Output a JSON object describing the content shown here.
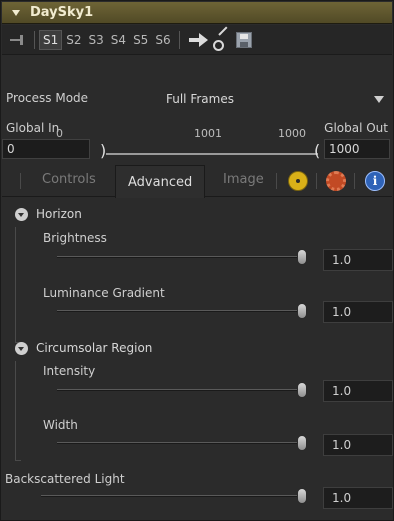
{
  "title": "DaySky1",
  "toolbar": {
    "slots": [
      "S1",
      "S2",
      "S3",
      "S4",
      "S5",
      "S6"
    ],
    "active_slot": "S1"
  },
  "process_mode": {
    "label": "Process Mode",
    "value": "Full Frames"
  },
  "range": {
    "global_in_label": "Global In",
    "global_out_label": "Global Out",
    "global_in_value": "0",
    "global_out_value": "1000",
    "tick_start": "0",
    "tick_mid": "1001",
    "tick_end": "1000"
  },
  "tabs": [
    "Controls",
    "Advanced",
    "Image"
  ],
  "active_tab": "Advanced",
  "sections": {
    "horizon": {
      "title": "Horizon",
      "brightness": {
        "label": "Brightness",
        "value": "1.0"
      },
      "luminance_gradient": {
        "label": "Luminance Gradient",
        "value": "1.0"
      }
    },
    "circumsolar": {
      "title": "Circumsolar Region",
      "intensity": {
        "label": "Intensity",
        "value": "1.0"
      },
      "width": {
        "label": "Width",
        "value": "1.0"
      }
    },
    "backscattered": {
      "label": "Backscattered Light",
      "value": "1.0"
    }
  }
}
